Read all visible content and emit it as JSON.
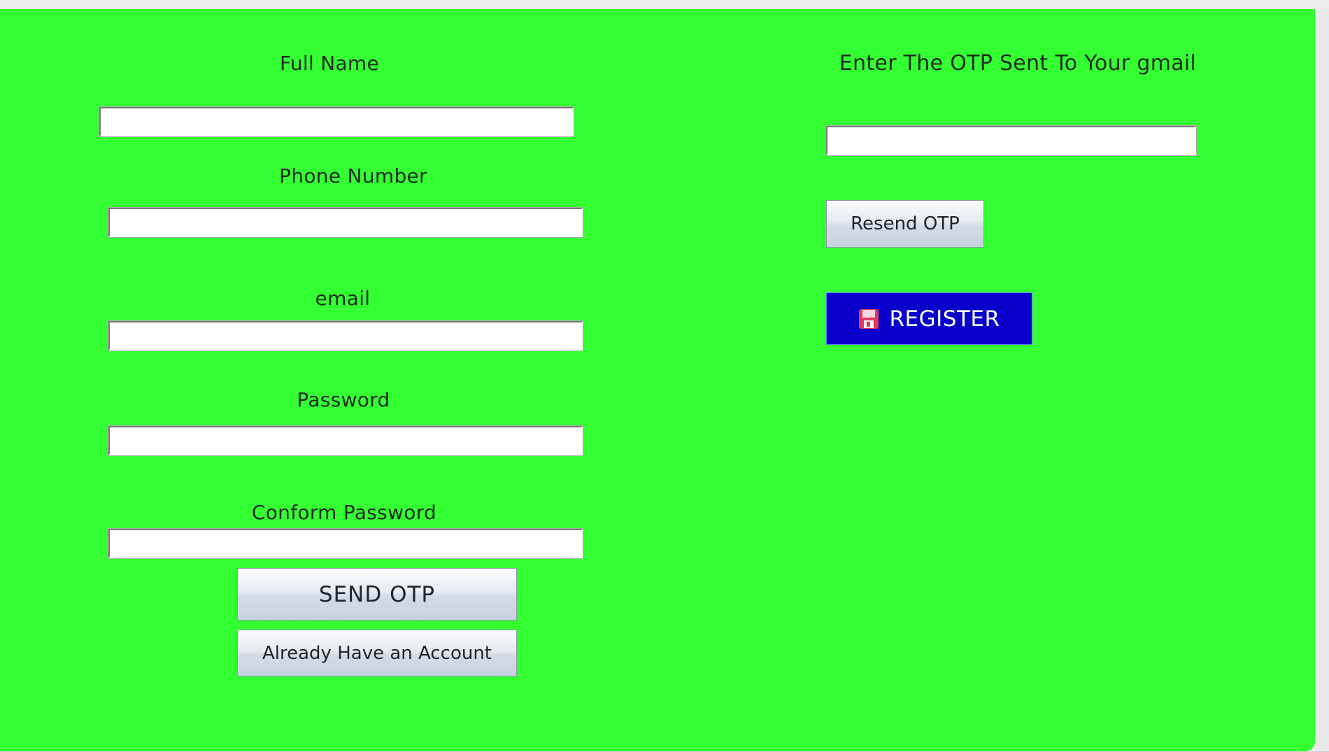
{
  "left_form": {
    "full_name": {
      "label": "Full Name",
      "value": ""
    },
    "phone_number": {
      "label": "Phone Number",
      "value": ""
    },
    "email": {
      "label": "email",
      "value": ""
    },
    "password": {
      "label": "Password",
      "value": ""
    },
    "confirm_password": {
      "label": "Conform Password",
      "value": ""
    },
    "send_otp_label": "SEND OTP",
    "already_account_label": "Already Have an Account"
  },
  "right_form": {
    "otp_label": "Enter The OTP Sent To Your gmail",
    "otp_value": "",
    "resend_label": "Resend OTP",
    "register_label": "REGISTER",
    "register_icon": "save-icon"
  },
  "colors": {
    "background": "#33ff33",
    "register_button": "#0a00cc",
    "label_text": "#1f2b1f"
  }
}
